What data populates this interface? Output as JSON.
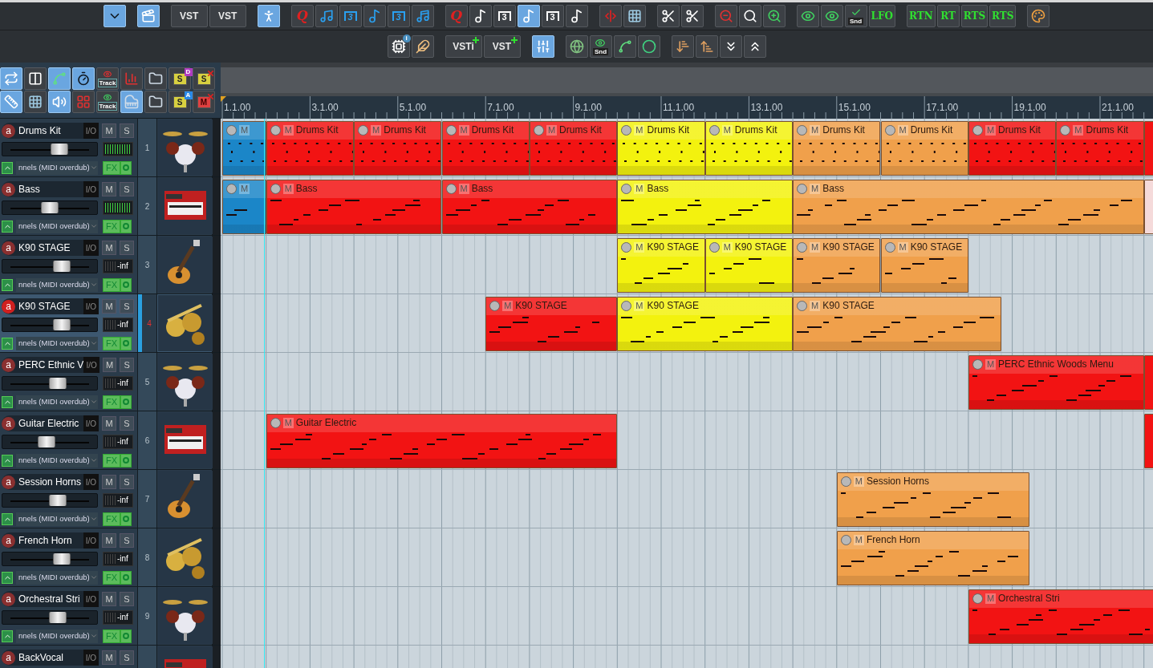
{
  "toolbar": {
    "rows": [
      {
        "groups": [
          [
            {
              "kind": "dropdown",
              "selected": true
            }
          ],
          [
            {
              "kind": "clapper",
              "selected": true
            }
          ],
          [
            {
              "kind": "text",
              "label": "VST",
              "selected": false
            },
            {
              "kind": "text",
              "label": "VST",
              "selected": false
            }
          ],
          [
            {
              "kind": "walk",
              "selected": true
            }
          ],
          [
            {
              "kind": "quantize",
              "label": "Q",
              "selected": false
            },
            {
              "kind": "note",
              "selected": false
            },
            {
              "kind": "triplet",
              "label": "3",
              "selected": false
            },
            {
              "kind": "note16",
              "selected": false
            },
            {
              "kind": "triplet",
              "label": "3",
              "selected": false
            },
            {
              "kind": "note32",
              "selected": false
            }
          ],
          [
            {
              "kind": "quantize-red",
              "label": "Q",
              "selected": false
            },
            {
              "kind": "note-grid",
              "selected": false
            },
            {
              "kind": "triplet-note",
              "label": "3",
              "selected": false
            },
            {
              "kind": "note-grid",
              "selected": true
            },
            {
              "kind": "triplet-note",
              "label": "3",
              "selected": false
            },
            {
              "kind": "note-grid",
              "selected": false
            }
          ],
          [
            {
              "kind": "marker",
              "selected": false
            },
            {
              "kind": "grid",
              "selected": false
            }
          ],
          [
            {
              "kind": "scissors",
              "selected": false
            },
            {
              "kind": "scissors",
              "selected": false
            }
          ],
          [
            {
              "kind": "zoom-out",
              "selected": false
            },
            {
              "kind": "zoom-fit",
              "selected": false
            },
            {
              "kind": "zoom-in",
              "selected": false
            }
          ],
          [
            {
              "kind": "eye-nodes",
              "selected": false
            },
            {
              "kind": "eye-nodes",
              "selected": false
            },
            {
              "kind": "check-snd",
              "label": "Snd",
              "selected": false
            },
            {
              "kind": "text-green",
              "label": "LFO",
              "selected": false
            }
          ],
          [
            {
              "kind": "text-green",
              "label": "RTN",
              "selected": false
            },
            {
              "kind": "text-green",
              "label": "RT",
              "selected": false
            },
            {
              "kind": "text-green",
              "label": "RTS",
              "selected": false
            },
            {
              "kind": "text-green",
              "label": "RTS",
              "selected": false
            }
          ],
          [
            {
              "kind": "palette",
              "selected": false
            }
          ]
        ]
      },
      {
        "groups": [
          [
            {
              "kind": "cpu-info",
              "label": "i",
              "selected": false
            },
            {
              "kind": "feather",
              "selected": false
            }
          ],
          [
            {
              "kind": "text-plus",
              "label": "VSTi",
              "selected": false
            },
            {
              "kind": "text-plus",
              "label": "VST",
              "selected": false
            }
          ],
          [
            {
              "kind": "mixer-eye",
              "selected": true
            }
          ],
          [
            {
              "kind": "globe-arrow",
              "selected": false
            },
            {
              "kind": "eye-snd",
              "label": "Snd",
              "selected": false
            },
            {
              "kind": "nodes",
              "selected": false
            },
            {
              "kind": "ring",
              "selected": false
            }
          ],
          [
            {
              "kind": "sort-down",
              "selected": false
            },
            {
              "kind": "sort-up",
              "selected": false
            },
            {
              "kind": "sort-down-all",
              "selected": false
            },
            {
              "kind": "sort-up-all",
              "selected": false
            }
          ]
        ]
      }
    ]
  },
  "track_tools": [
    [
      {
        "kind": "loop",
        "selected": true
      },
      {
        "kind": "split",
        "selected": false
      },
      {
        "kind": "nodes",
        "selected": true
      },
      {
        "kind": "metronome",
        "selected": true
      },
      {
        "kind": "eye-track",
        "label": "Track",
        "selected": false
      },
      {
        "kind": "eye-bars",
        "selected": false
      },
      {
        "kind": "folder",
        "selected": false
      },
      {
        "kind": "badge",
        "label": "S",
        "badge": "D",
        "color": "#b03cc0",
        "selected": false
      },
      {
        "kind": "delete",
        "label": "S",
        "selected": false
      }
    ],
    [
      {
        "kind": "ruler",
        "selected": true
      },
      {
        "kind": "grid",
        "selected": false
      },
      {
        "kind": "speaker",
        "selected": true
      },
      {
        "kind": "boxes",
        "selected": false
      },
      {
        "kind": "eye-track-green",
        "label": "Track",
        "selected": false
      },
      {
        "kind": "piano",
        "selected": true
      },
      {
        "kind": "folder",
        "selected": false
      },
      {
        "kind": "badge",
        "label": "S",
        "badge": "A",
        "color": "#2a8ae8",
        "selected": false
      },
      {
        "kind": "delete-red",
        "label": "M",
        "selected": false
      }
    ]
  ],
  "ruler": {
    "labels": [
      "1.1.00",
      "3.1.00",
      "5.1.00",
      "7.1.00",
      "9.1.00",
      "11.1.00",
      "13.1.00",
      "15.1.00",
      "17.1.00",
      "19.1.00",
      "21.1.00"
    ]
  },
  "tracks": [
    {
      "name": "Drums Kit",
      "arm": "a",
      "number": "1",
      "selected": false,
      "io": "I/O",
      "mute": "M",
      "solo": "S",
      "fader": {
        "level": 0.62
      },
      "signal": true,
      "input": "nnels (MIDI overdub)",
      "fx": "FX",
      "clips": [
        {
          "color": "#1b86c8",
          "mute": "M"
        },
        {
          "color": "#f21313",
          "mute": "M",
          "title": "Drums Kit"
        },
        {
          "color": "#f21313",
          "mute": "M",
          "title": "Drums Kit"
        },
        {
          "color": "#f21313",
          "mute": "M",
          "title": "Drums Kit"
        },
        {
          "color": "#f21313",
          "mute": "M",
          "title": "Drums Kit"
        },
        {
          "color": "#f3f20e",
          "mute": "M",
          "title": "Drums Kit"
        },
        {
          "color": "#f3f20e",
          "mute": "M",
          "title": "Drums Kit"
        },
        {
          "color": "#f0a04b",
          "mute": "M",
          "title": "Drums Kit"
        },
        {
          "color": "#f0a04b",
          "mute": "M",
          "title": "Drums Kit"
        },
        {
          "color": "#f21313",
          "mute": "M",
          "title": "Drums Kit"
        },
        {
          "color": "#f21313",
          "mute": "M",
          "title": "Drums Kit"
        },
        {
          "color": "#f21313"
        }
      ]
    },
    {
      "name": "Bass",
      "arm": "a",
      "number": "2",
      "selected": false,
      "io": "I/O",
      "mute": "M",
      "solo": "S",
      "fader": {
        "level": 0.5
      },
      "signal": true,
      "input": "nnels (MIDI overdub)",
      "fx": "FX",
      "clips": [
        {
          "color": "#1b86c8",
          "mute": "M"
        },
        {
          "color": "#f21313",
          "mute": "M",
          "title": "Bass"
        },
        {
          "color": "#f21313",
          "mute": "M",
          "title": "Bass"
        },
        {
          "color": "#f3f20e",
          "mute": "M",
          "title": "Bass"
        },
        {
          "color": "#f0a04b",
          "mute": "M",
          "title": "Bass"
        },
        {
          "color": "#f5dada"
        }
      ]
    },
    {
      "name": "K90 STAGE",
      "arm": "a",
      "number": "3",
      "selected": false,
      "io": "I/O",
      "mute": "M",
      "solo": "S",
      "fader": {
        "level": 0.66
      },
      "signal": false,
      "reading": "-inf",
      "input": "nnels (MIDI overdub)",
      "fx": "FX",
      "clips": [
        {
          "color": "#f3f20e",
          "mute": "M",
          "title": "K90 STAGE"
        },
        {
          "color": "#f3f20e",
          "mute": "M",
          "title": "K90 STAGE"
        },
        {
          "color": "#f0a04b",
          "mute": "M",
          "title": "K90 STAGE"
        },
        {
          "color": "#f0a04b",
          "mute": "M",
          "title": "K90 STAGE"
        }
      ]
    },
    {
      "name": "K90 STAGE",
      "arm": "a",
      "number": "4",
      "selected": true,
      "io": "I/O",
      "mute": "M",
      "solo": "S",
      "fader": {
        "level": 0.66
      },
      "signal": false,
      "reading": "-inf",
      "input": "nnels (MIDI overdub)",
      "fx": "FX",
      "clips": [
        {
          "color": "#f21313",
          "mute": "M",
          "title": "K90 STAGE"
        },
        {
          "color": "#f3f20e",
          "mute": "M",
          "title": "K90 STAGE"
        },
        {
          "color": "#f0a04b",
          "mute": "M",
          "title": "K90 STAGE"
        }
      ]
    },
    {
      "name": "PERC  Ethnic V",
      "arm": "a",
      "number": "5",
      "selected": false,
      "io": "I/O",
      "mute": "M",
      "solo": "S",
      "fader": {
        "level": 0.6
      },
      "signal": false,
      "reading": "-inf",
      "input": "nnels (MIDI overdub)",
      "fx": "FX",
      "clips": [
        {
          "color": "#f21313",
          "mute": "M",
          "title": "PERC  Ethnic Woods Menu"
        },
        {
          "color": "#f21313"
        }
      ]
    },
    {
      "name": "Guitar Electric",
      "arm": "a",
      "number": "6",
      "selected": false,
      "io": "I/O",
      "mute": "M",
      "solo": "S",
      "fader": {
        "level": 0.46
      },
      "signal": false,
      "reading": "-inf",
      "input": "nnels (MIDI overdub)",
      "fx": "FX",
      "clips": [
        {
          "color": "#f21313",
          "mute": "M",
          "title": "Guitar Electric"
        },
        {
          "color": "#f21313"
        }
      ]
    },
    {
      "name": "Session Horns",
      "arm": "a",
      "number": "7",
      "selected": false,
      "io": "I/O",
      "mute": "M",
      "solo": "S",
      "fader": {
        "level": 0.6
      },
      "signal": false,
      "reading": "-inf",
      "input": "nnels (MIDI overdub)",
      "fx": "FX",
      "clips": [
        {
          "color": "#f0a04b",
          "mute": "M",
          "title": "Session Horns"
        }
      ]
    },
    {
      "name": "French Horn",
      "arm": "a",
      "number": "8",
      "selected": false,
      "io": "I/O",
      "mute": "M",
      "solo": "S",
      "fader": {
        "level": 0.66
      },
      "signal": false,
      "reading": "-inf",
      "input": "nnels (MIDI overdub)",
      "fx": "FX",
      "clips": [
        {
          "color": "#f0a04b",
          "mute": "M",
          "title": "French Horn"
        }
      ]
    },
    {
      "name": "Orchestral Stri",
      "arm": "a",
      "number": "9",
      "selected": false,
      "io": "I/O",
      "mute": "M",
      "solo": "S",
      "fader": {
        "level": 0.6
      },
      "signal": false,
      "reading": "-inf",
      "input": "nnels (MIDI overdub)",
      "fx": "FX",
      "clips": [
        {
          "color": "#f21313",
          "mute": "M",
          "title": "Orchestral Stri"
        }
      ]
    },
    {
      "name": "BackVocal",
      "arm": "a",
      "selected": false,
      "io": "I/O",
      "mute": "M",
      "solo": "S"
    }
  ]
}
